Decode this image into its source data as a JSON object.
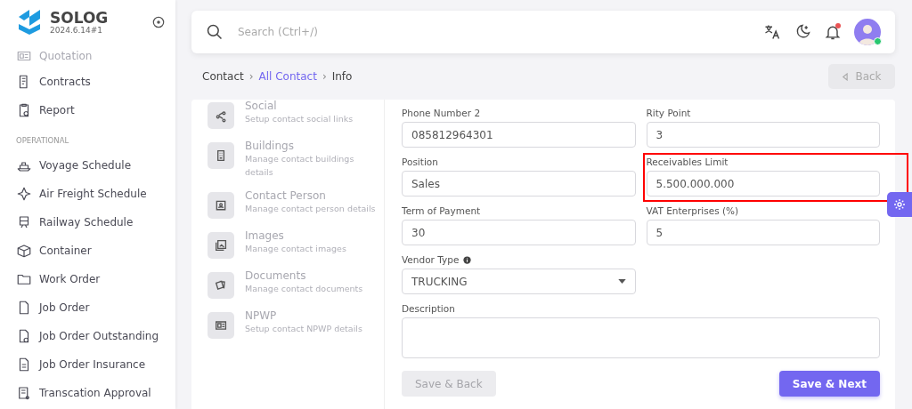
{
  "brand": {
    "name": "SOLOG",
    "version": "2024.6.14#1"
  },
  "sidebar": {
    "items": [
      {
        "kind": "item",
        "label": "Quotation",
        "dimmed": true
      },
      {
        "kind": "item",
        "label": "Contracts",
        "dimmed": false
      },
      {
        "kind": "item",
        "label": "Report",
        "dimmed": false
      },
      {
        "kind": "section",
        "label": "OPERATIONAL"
      },
      {
        "kind": "item",
        "label": "Voyage Schedule",
        "dimmed": false
      },
      {
        "kind": "item",
        "label": "Air Freight Schedule",
        "dimmed": false
      },
      {
        "kind": "item",
        "label": "Railway Schedule",
        "dimmed": false
      },
      {
        "kind": "item",
        "label": "Container",
        "dimmed": false
      },
      {
        "kind": "item",
        "label": "Work Order",
        "dimmed": false
      },
      {
        "kind": "item",
        "label": "Job Order",
        "dimmed": false
      },
      {
        "kind": "item",
        "label": "Job Order Outstanding",
        "dimmed": false
      },
      {
        "kind": "item",
        "label": "Job Order Insurance",
        "dimmed": false
      },
      {
        "kind": "item",
        "label": "Transcation Approval",
        "dimmed": false
      }
    ]
  },
  "search": {
    "placeholder": "Search (Ctrl+/)"
  },
  "header": {
    "notification": true,
    "online": true
  },
  "breadcrumb_separator": "›",
  "breadcrumb": [
    {
      "label": "Contact",
      "link": false
    },
    {
      "label": "All Contact",
      "link": true
    },
    {
      "label": "Info",
      "link": false
    }
  ],
  "back_button": {
    "label": "Back",
    "disabled": true
  },
  "steps": [
    {
      "title": "Social",
      "subtitle": "Setup contact social links"
    },
    {
      "title": "Buildings",
      "subtitle": "Manage contact buildings details"
    },
    {
      "title": "Contact Person",
      "subtitle": "Manage contact person details"
    },
    {
      "title": "Images",
      "subtitle": "Manage contact images"
    },
    {
      "title": "Documents",
      "subtitle": "Manage contact documents"
    },
    {
      "title": "NPWP",
      "subtitle": "Setup contact NPWP details"
    }
  ],
  "fields": [
    {
      "kind": "text",
      "label": "Phone Number 2",
      "value": "085812964301",
      "highlighted": false,
      "info": false
    },
    {
      "kind": "text",
      "label": "Rity Point",
      "value": "3",
      "highlighted": false,
      "info": false
    },
    {
      "kind": "text",
      "label": "Position",
      "value": "Sales",
      "highlighted": false,
      "info": false
    },
    {
      "kind": "text",
      "label": "Receivables Limit",
      "value": "5.500.000.000",
      "highlighted": true,
      "info": false
    },
    {
      "kind": "text",
      "label": "Term of Payment",
      "value": "30",
      "highlighted": false,
      "info": false
    },
    {
      "kind": "text",
      "label": "VAT Enterprises (%)",
      "value": "5",
      "highlighted": false,
      "info": false
    },
    {
      "kind": "select",
      "label": "Vendor Type",
      "value": "TRUCKING",
      "highlighted": false,
      "info": true
    },
    {
      "kind": "textarea",
      "label": "Description",
      "highlighted": false,
      "info": false
    }
  ],
  "actions": [
    {
      "label": "Save & Back",
      "primary": false,
      "disabled": true
    },
    {
      "label": "Save & Next",
      "primary": true,
      "disabled": false
    }
  ]
}
